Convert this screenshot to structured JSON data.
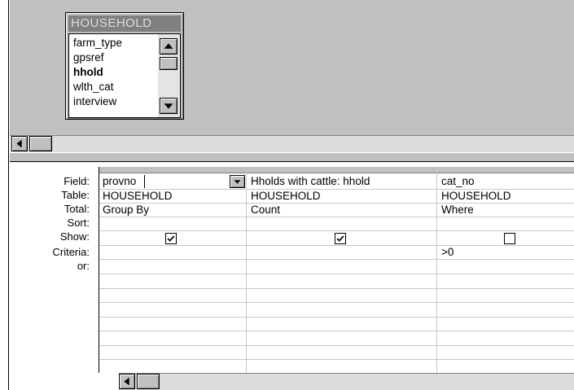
{
  "field_list": {
    "title": "HOUSEHOLD",
    "items": [
      "farm_type",
      "gpsref",
      "hhold",
      "wlth_cat",
      "interview"
    ],
    "bold_item": "hhold"
  },
  "grid": {
    "row_labels": [
      "Field:",
      "Table:",
      "Total:",
      "Sort:",
      "Show:",
      "Criteria:",
      "or:"
    ],
    "columns": [
      {
        "field": "provno",
        "table": "HOUSEHOLD",
        "total": "Group By",
        "sort": "",
        "show": true,
        "criteria": ""
      },
      {
        "field": "Hholds with cattle: hhold",
        "table": "HOUSEHOLD",
        "total": "Count",
        "sort": "",
        "show": true,
        "criteria": ""
      },
      {
        "field": "cat_no",
        "table": "HOUSEHOLD",
        "total": "Where",
        "sort": "",
        "show": false,
        "criteria": ">0"
      }
    ]
  },
  "icons": {
    "scroll_up": "arrow-up-icon",
    "scroll_down": "arrow-down-icon",
    "scroll_left": "arrow-left-icon",
    "dropdown": "chevron-down-icon",
    "check": "checkmark-icon"
  }
}
